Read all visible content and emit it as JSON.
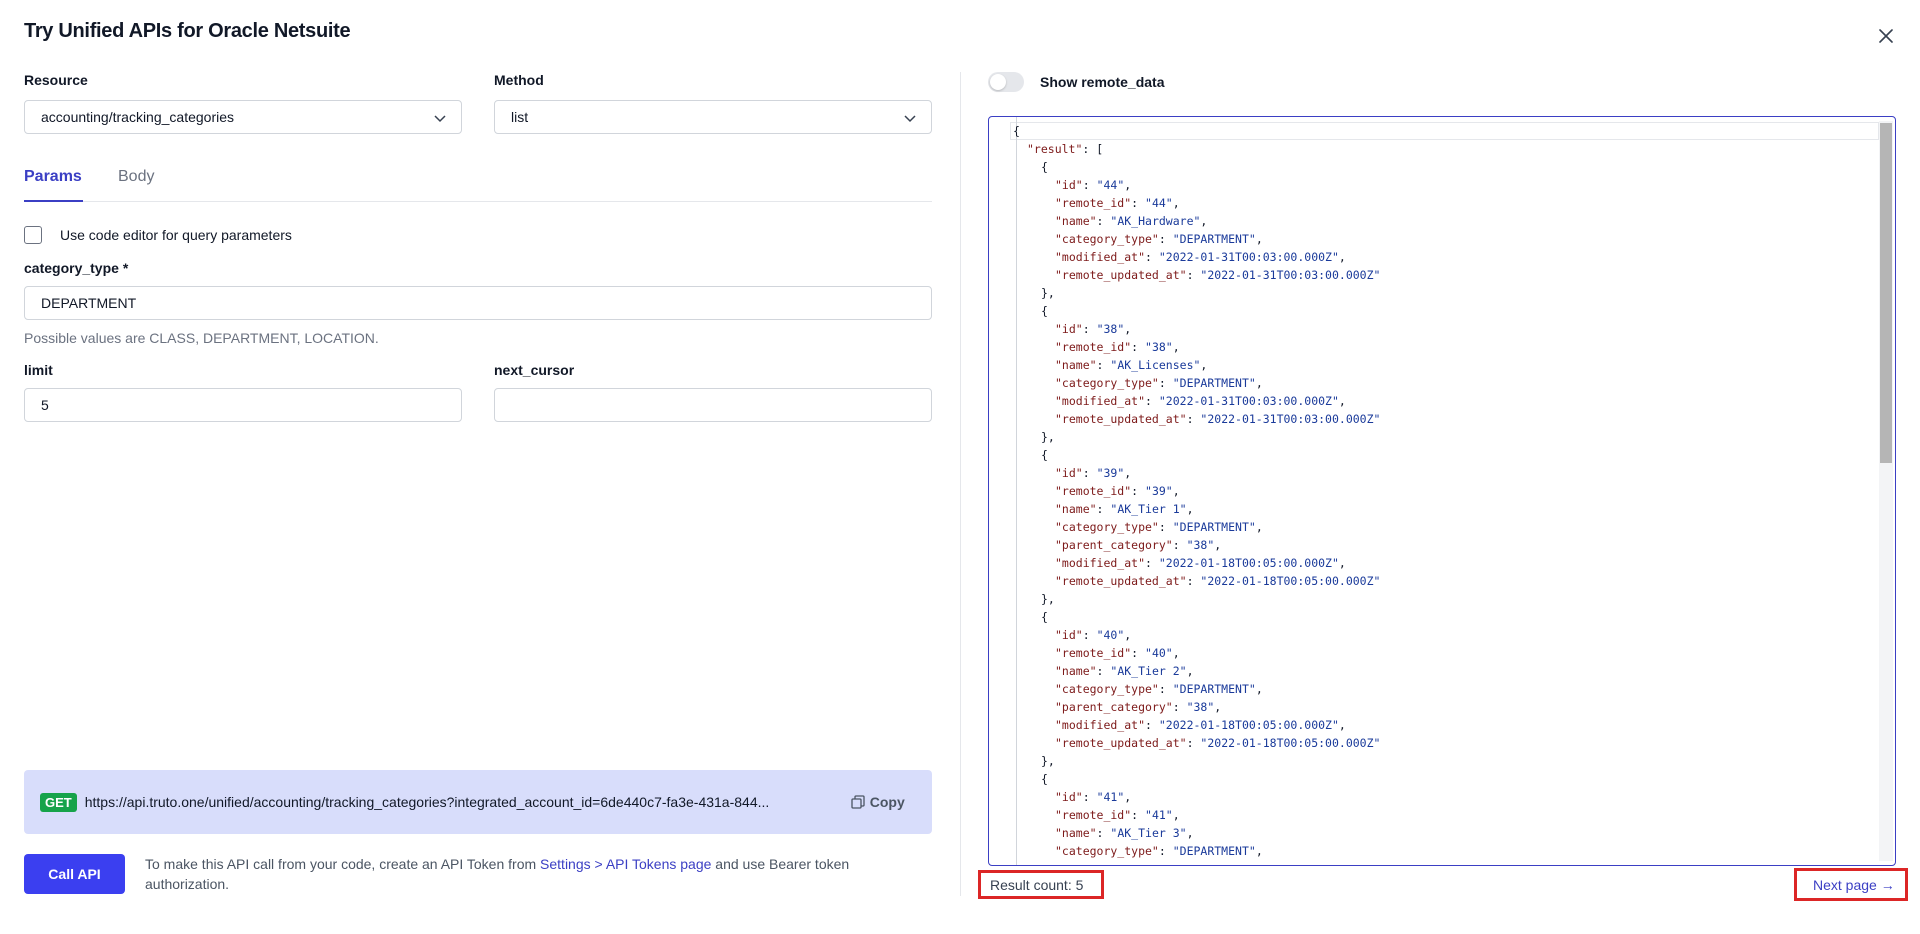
{
  "dialog": {
    "title": "Try Unified APIs for Oracle Netsuite",
    "close_icon": "close-icon"
  },
  "form": {
    "resource_label": "Resource",
    "resource_value": "accounting/tracking_categories",
    "method_label": "Method",
    "method_value": "list",
    "tabs": [
      {
        "label": "Params",
        "active": true
      },
      {
        "label": "Body",
        "active": false
      }
    ],
    "code_editor_label": "Use code editor for query parameters",
    "code_editor_checked": false,
    "category_type_label": "category_type *",
    "category_type_value": "DEPARTMENT",
    "category_type_help": "Possible values are CLASS, DEPARTMENT, LOCATION.",
    "limit_label": "limit",
    "limit_value": "5",
    "next_cursor_label": "next_cursor",
    "next_cursor_value": ""
  },
  "request": {
    "method": "GET",
    "url": "https://api.truto.one/unified/accounting/tracking_categories?integrated_account_id=6de440c7-fa3e-431a-844...",
    "copy_label": "Copy",
    "call_label": "Call API",
    "note_prefix": "To make this API call from your code, create an API Token from ",
    "note_link": "Settings > API Tokens page",
    "note_suffix": " and use Bearer token authorization."
  },
  "response": {
    "toggle_label": "Show remote_data",
    "toggle_on": false,
    "result_count": "Result count: 5",
    "next_page": "Next page →",
    "lines": [
      {
        "indent": 0,
        "parts": [
          {
            "t": "{",
            "c": "p"
          }
        ]
      },
      {
        "indent": 1,
        "parts": [
          {
            "t": "\"result\"",
            "c": "k"
          },
          {
            "t": ": [",
            "c": "p"
          }
        ]
      },
      {
        "indent": 2,
        "parts": [
          {
            "t": "{",
            "c": "p"
          }
        ]
      },
      {
        "indent": 3,
        "parts": [
          {
            "t": "\"id\"",
            "c": "k"
          },
          {
            "t": ": ",
            "c": "p"
          },
          {
            "t": "\"44\"",
            "c": "s"
          },
          {
            "t": ",",
            "c": "p"
          }
        ]
      },
      {
        "indent": 3,
        "parts": [
          {
            "t": "\"remote_id\"",
            "c": "k"
          },
          {
            "t": ": ",
            "c": "p"
          },
          {
            "t": "\"44\"",
            "c": "s"
          },
          {
            "t": ",",
            "c": "p"
          }
        ]
      },
      {
        "indent": 3,
        "parts": [
          {
            "t": "\"name\"",
            "c": "k"
          },
          {
            "t": ": ",
            "c": "p"
          },
          {
            "t": "\"AK_Hardware\"",
            "c": "s"
          },
          {
            "t": ",",
            "c": "p"
          }
        ]
      },
      {
        "indent": 3,
        "parts": [
          {
            "t": "\"category_type\"",
            "c": "k"
          },
          {
            "t": ": ",
            "c": "p"
          },
          {
            "t": "\"DEPARTMENT\"",
            "c": "s"
          },
          {
            "t": ",",
            "c": "p"
          }
        ]
      },
      {
        "indent": 3,
        "parts": [
          {
            "t": "\"modified_at\"",
            "c": "k"
          },
          {
            "t": ": ",
            "c": "p"
          },
          {
            "t": "\"2022-01-31T00:03:00.000Z\"",
            "c": "s"
          },
          {
            "t": ",",
            "c": "p"
          }
        ]
      },
      {
        "indent": 3,
        "parts": [
          {
            "t": "\"remote_updated_at\"",
            "c": "k"
          },
          {
            "t": ": ",
            "c": "p"
          },
          {
            "t": "\"2022-01-31T00:03:00.000Z\"",
            "c": "s"
          }
        ]
      },
      {
        "indent": 2,
        "parts": [
          {
            "t": "},",
            "c": "p"
          }
        ]
      },
      {
        "indent": 2,
        "parts": [
          {
            "t": "{",
            "c": "p"
          }
        ]
      },
      {
        "indent": 3,
        "parts": [
          {
            "t": "\"id\"",
            "c": "k"
          },
          {
            "t": ": ",
            "c": "p"
          },
          {
            "t": "\"38\"",
            "c": "s"
          },
          {
            "t": ",",
            "c": "p"
          }
        ]
      },
      {
        "indent": 3,
        "parts": [
          {
            "t": "\"remote_id\"",
            "c": "k"
          },
          {
            "t": ": ",
            "c": "p"
          },
          {
            "t": "\"38\"",
            "c": "s"
          },
          {
            "t": ",",
            "c": "p"
          }
        ]
      },
      {
        "indent": 3,
        "parts": [
          {
            "t": "\"name\"",
            "c": "k"
          },
          {
            "t": ": ",
            "c": "p"
          },
          {
            "t": "\"AK_Licenses\"",
            "c": "s"
          },
          {
            "t": ",",
            "c": "p"
          }
        ]
      },
      {
        "indent": 3,
        "parts": [
          {
            "t": "\"category_type\"",
            "c": "k"
          },
          {
            "t": ": ",
            "c": "p"
          },
          {
            "t": "\"DEPARTMENT\"",
            "c": "s"
          },
          {
            "t": ",",
            "c": "p"
          }
        ]
      },
      {
        "indent": 3,
        "parts": [
          {
            "t": "\"modified_at\"",
            "c": "k"
          },
          {
            "t": ": ",
            "c": "p"
          },
          {
            "t": "\"2022-01-31T00:03:00.000Z\"",
            "c": "s"
          },
          {
            "t": ",",
            "c": "p"
          }
        ]
      },
      {
        "indent": 3,
        "parts": [
          {
            "t": "\"remote_updated_at\"",
            "c": "k"
          },
          {
            "t": ": ",
            "c": "p"
          },
          {
            "t": "\"2022-01-31T00:03:00.000Z\"",
            "c": "s"
          }
        ]
      },
      {
        "indent": 2,
        "parts": [
          {
            "t": "},",
            "c": "p"
          }
        ]
      },
      {
        "indent": 2,
        "parts": [
          {
            "t": "{",
            "c": "p"
          }
        ]
      },
      {
        "indent": 3,
        "parts": [
          {
            "t": "\"id\"",
            "c": "k"
          },
          {
            "t": ": ",
            "c": "p"
          },
          {
            "t": "\"39\"",
            "c": "s"
          },
          {
            "t": ",",
            "c": "p"
          }
        ]
      },
      {
        "indent": 3,
        "parts": [
          {
            "t": "\"remote_id\"",
            "c": "k"
          },
          {
            "t": ": ",
            "c": "p"
          },
          {
            "t": "\"39\"",
            "c": "s"
          },
          {
            "t": ",",
            "c": "p"
          }
        ]
      },
      {
        "indent": 3,
        "parts": [
          {
            "t": "\"name\"",
            "c": "k"
          },
          {
            "t": ": ",
            "c": "p"
          },
          {
            "t": "\"AK_Tier 1\"",
            "c": "s"
          },
          {
            "t": ",",
            "c": "p"
          }
        ]
      },
      {
        "indent": 3,
        "parts": [
          {
            "t": "\"category_type\"",
            "c": "k"
          },
          {
            "t": ": ",
            "c": "p"
          },
          {
            "t": "\"DEPARTMENT\"",
            "c": "s"
          },
          {
            "t": ",",
            "c": "p"
          }
        ]
      },
      {
        "indent": 3,
        "parts": [
          {
            "t": "\"parent_category\"",
            "c": "k"
          },
          {
            "t": ": ",
            "c": "p"
          },
          {
            "t": "\"38\"",
            "c": "s"
          },
          {
            "t": ",",
            "c": "p"
          }
        ]
      },
      {
        "indent": 3,
        "parts": [
          {
            "t": "\"modified_at\"",
            "c": "k"
          },
          {
            "t": ": ",
            "c": "p"
          },
          {
            "t": "\"2022-01-18T00:05:00.000Z\"",
            "c": "s"
          },
          {
            "t": ",",
            "c": "p"
          }
        ]
      },
      {
        "indent": 3,
        "parts": [
          {
            "t": "\"remote_updated_at\"",
            "c": "k"
          },
          {
            "t": ": ",
            "c": "p"
          },
          {
            "t": "\"2022-01-18T00:05:00.000Z\"",
            "c": "s"
          }
        ]
      },
      {
        "indent": 2,
        "parts": [
          {
            "t": "},",
            "c": "p"
          }
        ]
      },
      {
        "indent": 2,
        "parts": [
          {
            "t": "{",
            "c": "p"
          }
        ]
      },
      {
        "indent": 3,
        "parts": [
          {
            "t": "\"id\"",
            "c": "k"
          },
          {
            "t": ": ",
            "c": "p"
          },
          {
            "t": "\"40\"",
            "c": "s"
          },
          {
            "t": ",",
            "c": "p"
          }
        ]
      },
      {
        "indent": 3,
        "parts": [
          {
            "t": "\"remote_id\"",
            "c": "k"
          },
          {
            "t": ": ",
            "c": "p"
          },
          {
            "t": "\"40\"",
            "c": "s"
          },
          {
            "t": ",",
            "c": "p"
          }
        ]
      },
      {
        "indent": 3,
        "parts": [
          {
            "t": "\"name\"",
            "c": "k"
          },
          {
            "t": ": ",
            "c": "p"
          },
          {
            "t": "\"AK_Tier 2\"",
            "c": "s"
          },
          {
            "t": ",",
            "c": "p"
          }
        ]
      },
      {
        "indent": 3,
        "parts": [
          {
            "t": "\"category_type\"",
            "c": "k"
          },
          {
            "t": ": ",
            "c": "p"
          },
          {
            "t": "\"DEPARTMENT\"",
            "c": "s"
          },
          {
            "t": ",",
            "c": "p"
          }
        ]
      },
      {
        "indent": 3,
        "parts": [
          {
            "t": "\"parent_category\"",
            "c": "k"
          },
          {
            "t": ": ",
            "c": "p"
          },
          {
            "t": "\"38\"",
            "c": "s"
          },
          {
            "t": ",",
            "c": "p"
          }
        ]
      },
      {
        "indent": 3,
        "parts": [
          {
            "t": "\"modified_at\"",
            "c": "k"
          },
          {
            "t": ": ",
            "c": "p"
          },
          {
            "t": "\"2022-01-18T00:05:00.000Z\"",
            "c": "s"
          },
          {
            "t": ",",
            "c": "p"
          }
        ]
      },
      {
        "indent": 3,
        "parts": [
          {
            "t": "\"remote_updated_at\"",
            "c": "k"
          },
          {
            "t": ": ",
            "c": "p"
          },
          {
            "t": "\"2022-01-18T00:05:00.000Z\"",
            "c": "s"
          }
        ]
      },
      {
        "indent": 2,
        "parts": [
          {
            "t": "},",
            "c": "p"
          }
        ]
      },
      {
        "indent": 2,
        "parts": [
          {
            "t": "{",
            "c": "p"
          }
        ]
      },
      {
        "indent": 3,
        "parts": [
          {
            "t": "\"id\"",
            "c": "k"
          },
          {
            "t": ": ",
            "c": "p"
          },
          {
            "t": "\"41\"",
            "c": "s"
          },
          {
            "t": ",",
            "c": "p"
          }
        ]
      },
      {
        "indent": 3,
        "parts": [
          {
            "t": "\"remote_id\"",
            "c": "k"
          },
          {
            "t": ": ",
            "c": "p"
          },
          {
            "t": "\"41\"",
            "c": "s"
          },
          {
            "t": ",",
            "c": "p"
          }
        ]
      },
      {
        "indent": 3,
        "parts": [
          {
            "t": "\"name\"",
            "c": "k"
          },
          {
            "t": ": ",
            "c": "p"
          },
          {
            "t": "\"AK_Tier 3\"",
            "c": "s"
          },
          {
            "t": ",",
            "c": "p"
          }
        ]
      },
      {
        "indent": 3,
        "parts": [
          {
            "t": "\"category_type\"",
            "c": "k"
          },
          {
            "t": ": ",
            "c": "p"
          },
          {
            "t": "\"DEPARTMENT\"",
            "c": "s"
          },
          {
            "t": ",",
            "c": "p"
          }
        ]
      }
    ]
  },
  "colors": {
    "accent": "#3b3fc4",
    "primary_button": "#3b3ff0",
    "url_bar_bg": "#d8ddfb",
    "get_badge": "#16a34a",
    "highlight_box": "#dc2626"
  }
}
